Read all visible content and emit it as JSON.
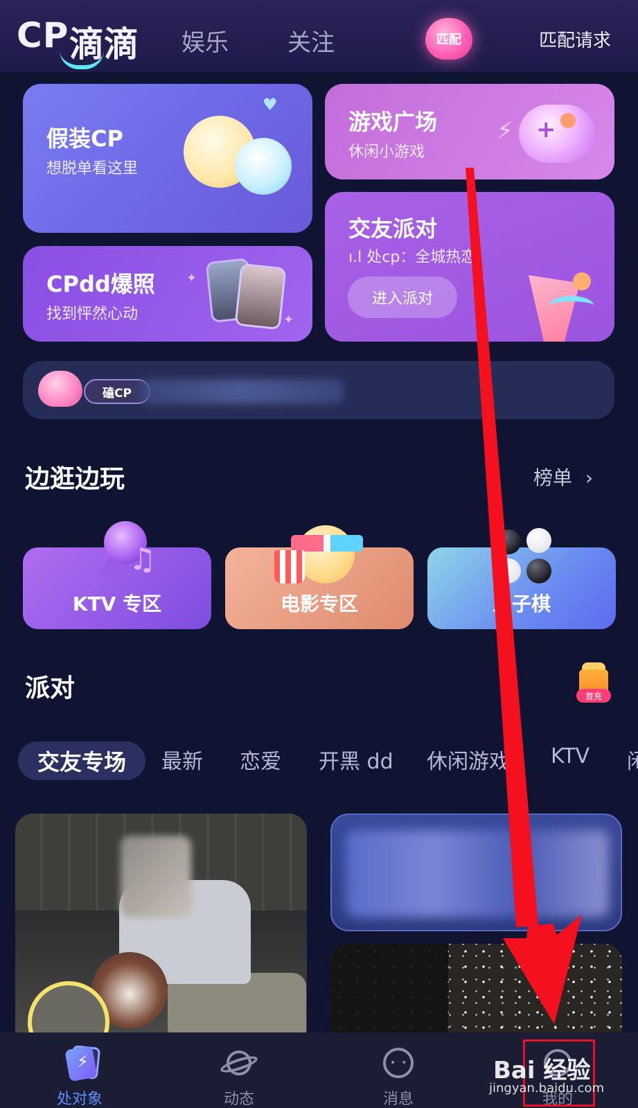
{
  "header": {
    "logo_prefix": "CP",
    "logo_name": "滴滴",
    "tabs": [
      "娱乐",
      "关注"
    ],
    "match_badge": "匹配",
    "match_request": "匹配请求"
  },
  "cards": {
    "fake_cp": {
      "title": "假装CP",
      "subtitle": "想脱单看这里"
    },
    "game_plaza": {
      "title": "游戏广场",
      "subtitle": "休闲小游戏"
    },
    "cpdd_photo": {
      "title": "CPdd爆照",
      "subtitle": "找到怦然心动"
    },
    "party": {
      "title": "交友派对",
      "subtitle": "处cp：全城热恋",
      "signal": "ı.l",
      "button": "进入派对"
    }
  },
  "cp_banner": {
    "badge": "磕CP"
  },
  "section_play": {
    "title": "边逛边玩",
    "rank_label": "榜单",
    "chevron": "›",
    "tiles": [
      {
        "label": "KTV 专区",
        "icon": "microphone-icon"
      },
      {
        "label": "电影专区",
        "icon": "popcorn-icon"
      },
      {
        "label": "五子棋",
        "icon": "go-stones-icon"
      }
    ]
  },
  "section_party": {
    "title": "派对",
    "gift_tag": "首充"
  },
  "categories": {
    "active": "交友专场",
    "items": [
      "最新",
      "恋爱",
      "开黑 dd",
      "休闲游戏",
      "KTV",
      "闲"
    ]
  },
  "bottom_nav": {
    "items": [
      {
        "label": "处对象",
        "active": true
      },
      {
        "label": "动态",
        "active": false
      },
      {
        "label": "消息",
        "active": false
      },
      {
        "label": "我的",
        "active": false
      }
    ]
  },
  "watermark": {
    "brand": "Bai 经验",
    "url": "jingyan.baidu.com"
  },
  "colors": {
    "background": "#0f1433",
    "accent_blue": "#5f8dff",
    "annotation_red": "#e8102a",
    "logo_smile": "#5ee7f2"
  }
}
